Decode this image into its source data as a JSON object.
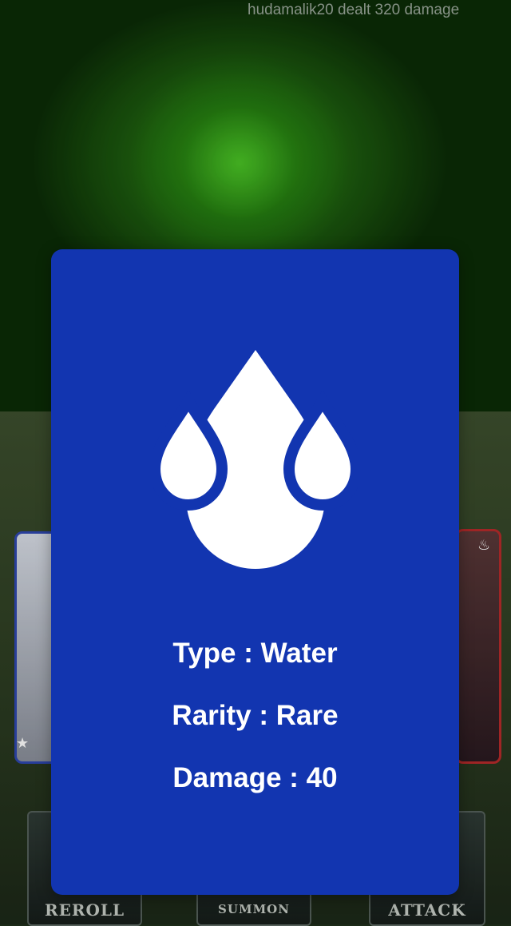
{
  "combat_log": "hudamalik20 dealt 320 damage",
  "actions": {
    "reroll": "REROLL",
    "summon": "SUMMON",
    "attack": "ATTACK"
  },
  "card_detail": {
    "icon": "water-drops-icon",
    "type_line": "Type : Water",
    "rarity_line": "Rarity : Rare",
    "damage_line": "Damage : 40",
    "colors": {
      "background": "#1235b0",
      "text": "#ffffff"
    }
  }
}
